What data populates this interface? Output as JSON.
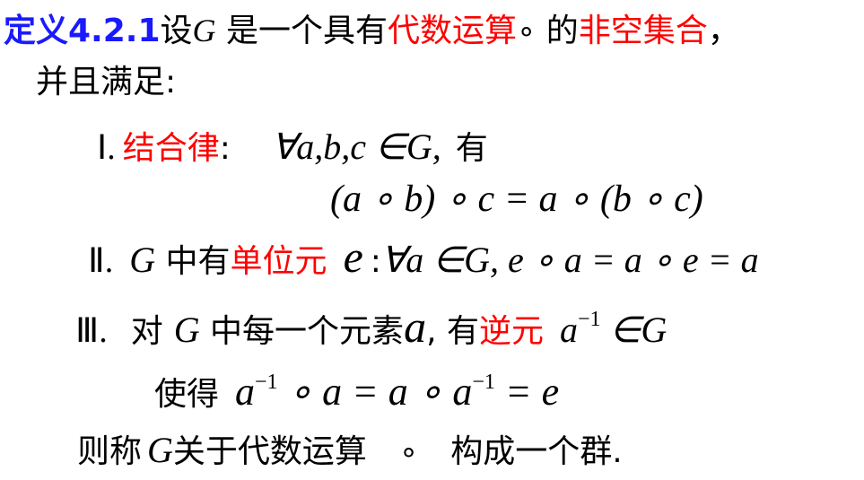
{
  "def": {
    "label": "定义4.2.1",
    "t1": "设",
    "G": "G",
    "t2": " 是一个具有",
    "red1": "代数运算",
    "op": "∘",
    "t3": " 的",
    "red2": "非空集合",
    "t4": "，",
    "line2": "并且满足:"
  },
  "axiom1": {
    "num": "Ⅰ.",
    "name": "结合律",
    "colon": ":",
    "cond": "∀a,b,c ∈G,",
    "you": "有",
    "formula": "(a ∘ b) ∘ c = a ∘ (b ∘ c)"
  },
  "axiom2": {
    "num": "Ⅱ.",
    "G": "G",
    "t1": " 中有",
    "name": "单位元",
    "e": "e",
    "colon": ":",
    "formula": "∀a ∈G, e ∘ a = a ∘ e = a"
  },
  "axiom3": {
    "num": "Ⅲ.",
    "t1": "对",
    "G": "G",
    "t2": " 中每一个元素",
    "a": "a",
    "t3": ", 有",
    "name": "逆元",
    "inv": "a",
    "inv_sup": "−1",
    "in_G": " ∈G",
    "t4": "使得",
    "f1": "a",
    "f1_sup": "−1",
    "f2": " ∘ a = a ∘ a",
    "f2_sup": "−1",
    "f3": " = e"
  },
  "conclusion": {
    "t1": "则称",
    "G": "G",
    "t2": "关于代数运算",
    "op": "∘",
    "t3": "构成一个群."
  }
}
